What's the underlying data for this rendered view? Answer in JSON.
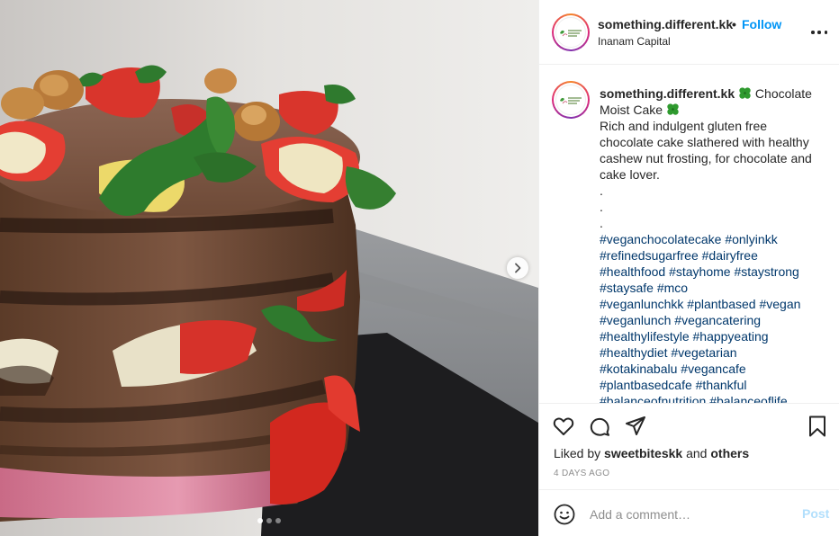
{
  "post": {
    "username": "something.different.kk",
    "follow_separator": "•",
    "follow_label": "Follow",
    "location": "Inanam Capital",
    "avatar_text": "Something Different"
  },
  "caption": {
    "username": "something.different.kk",
    "title_line1": "Chocolate",
    "title_line2": "Moist Cake",
    "body_lines": [
      "Rich and indulgent gluten free",
      "chocolate cake slathered with healthy",
      "cashew nut frosting, for chocolate and",
      "cake lover.",
      ".",
      ".",
      "."
    ],
    "hashtag_lines": [
      "#veganchocolatecake #onlyinkk",
      "#refinedsugarfree #dairyfree",
      "#healthfood #stayhome #staystrong",
      "#staysafe #mco",
      "#veganlunchkk #plantbased #vegan",
      "#veganlunch #vegancatering",
      "#healthylifestyle #happyeating",
      "#healthydiet #vegetarian",
      "#kotakinabalu #vegancafe",
      "#plantbasedcafe #thankful",
      "#balanceofnutrition #balanceoflife"
    ],
    "emoji": "four-leaf-clover"
  },
  "engagement": {
    "liked_by_prefix": "Liked by",
    "liked_by_user": "sweetbiteskk",
    "and_text": "and",
    "others_label": "others",
    "time_ago": "4 DAYS AGO"
  },
  "comment": {
    "placeholder": "Add a comment…",
    "post_label": "Post"
  },
  "carousel": {
    "total_slides": 3,
    "current_slide": 1
  },
  "colors": {
    "accent": "#0095f6",
    "hashtag": "#00376b",
    "post_disabled": "#b2dffc",
    "muted": "#8e8e8e"
  },
  "icons": [
    "heart-icon",
    "comment-icon",
    "share-icon",
    "bookmark-icon",
    "emoji-icon",
    "more-icon",
    "chevron-right-icon"
  ]
}
